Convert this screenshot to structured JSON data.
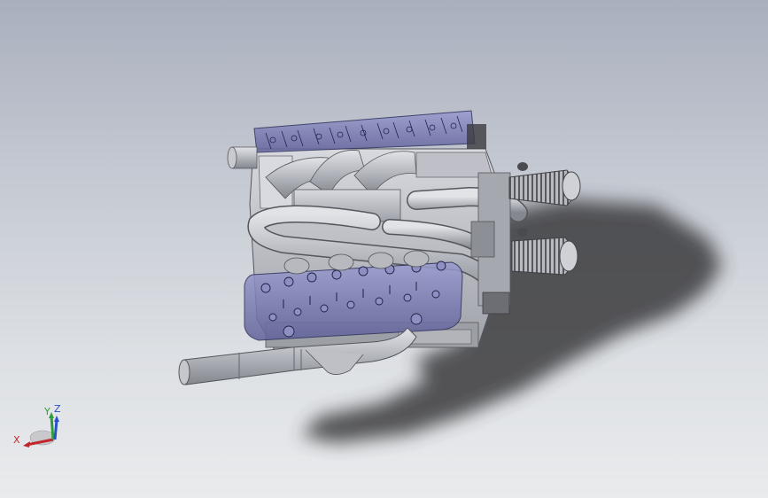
{
  "viewport": {
    "background_top": "#a9afbd",
    "background_bottom": "#e9ebed"
  },
  "model": {
    "body_color": "#c7c8ce",
    "valve_cover_color": "#7c7fb4",
    "shadow_color": "#3a3a3a"
  },
  "triad": {
    "x_label": "X",
    "y_label": "Y",
    "z_label": "Z",
    "x_color": "#c0282c",
    "y_color": "#2e9e3a",
    "z_color": "#2a4fd0"
  }
}
